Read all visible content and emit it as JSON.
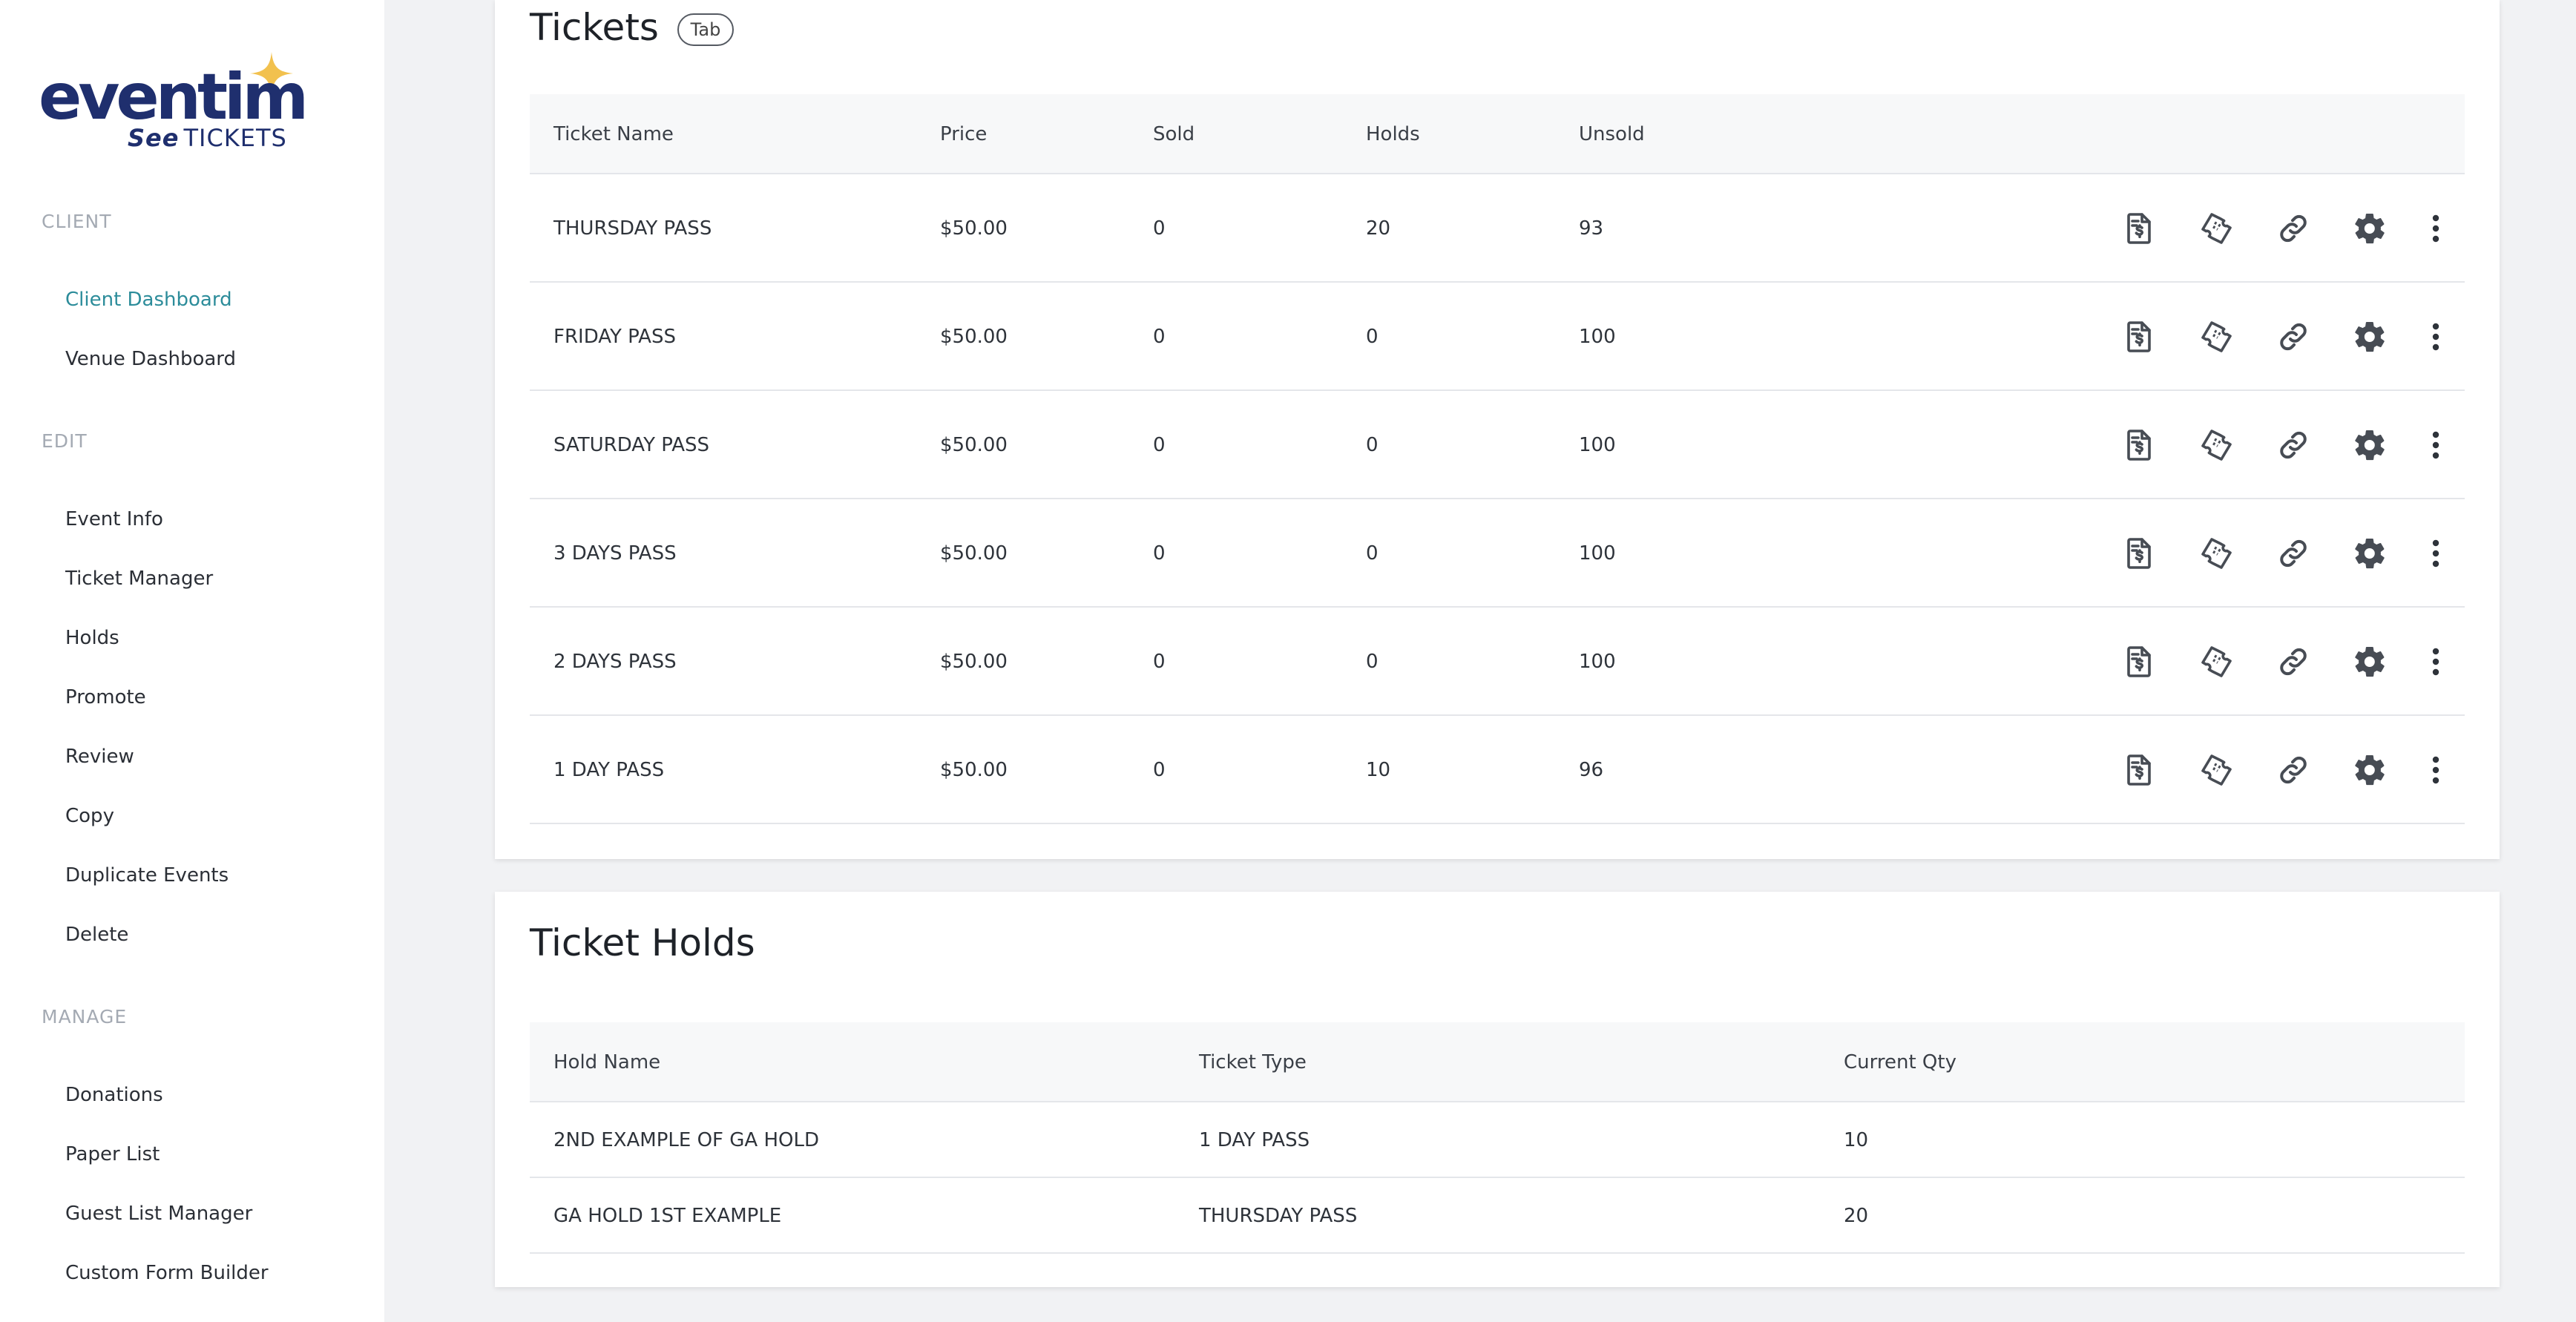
{
  "brand": {
    "word": "eventim",
    "sub_bold": "See",
    "sub_light": "TICKETS"
  },
  "sidebar": {
    "sections": [
      {
        "label": "CLIENT",
        "items": [
          "Client Dashboard",
          "Venue Dashboard"
        ]
      },
      {
        "label": "EDIT",
        "items": [
          "Event Info",
          "Ticket Manager",
          "Holds",
          "Promote",
          "Review",
          "Copy",
          "Duplicate Events",
          "Delete"
        ]
      },
      {
        "label": "MANAGE",
        "items": [
          "Donations",
          "Paper List",
          "Guest List Manager",
          "Custom Form Builder"
        ]
      }
    ],
    "active_item": "Client Dashboard"
  },
  "tickets": {
    "title": "Tickets",
    "badge": "Tab",
    "columns": [
      "Ticket Name",
      "Price",
      "Sold",
      "Holds",
      "Unsold"
    ],
    "rows": [
      [
        "THURSDAY PASS",
        "$50.00",
        "0",
        "20",
        "93"
      ],
      [
        "FRIDAY PASS",
        "$50.00",
        "0",
        "0",
        "100"
      ],
      [
        "SATURDAY PASS",
        "$50.00",
        "0",
        "0",
        "100"
      ],
      [
        "3 DAYS PASS",
        "$50.00",
        "0",
        "0",
        "100"
      ],
      [
        "2 DAYS PASS",
        "$50.00",
        "0",
        "0",
        "100"
      ],
      [
        "1 DAY PASS",
        "$50.00",
        "0",
        "10",
        "96"
      ]
    ],
    "row_actions": [
      "invoice-icon",
      "ticket-icon",
      "link-icon",
      "gear-icon",
      "more-vertical-icon"
    ]
  },
  "holds": {
    "title": "Ticket Holds",
    "columns": [
      "Hold Name",
      "Ticket Type",
      "Current Qty"
    ],
    "rows": [
      [
        "2ND EXAMPLE OF GA HOLD",
        "1 DAY PASS",
        "10"
      ],
      [
        "GA HOLD 1ST EXAMPLE",
        "THURSDAY PASS",
        "20"
      ]
    ]
  },
  "colors": {
    "accent": "#2c8c9a",
    "brand": "#1f2f6e",
    "star": "#f2c14e",
    "icon": "#474c54"
  }
}
